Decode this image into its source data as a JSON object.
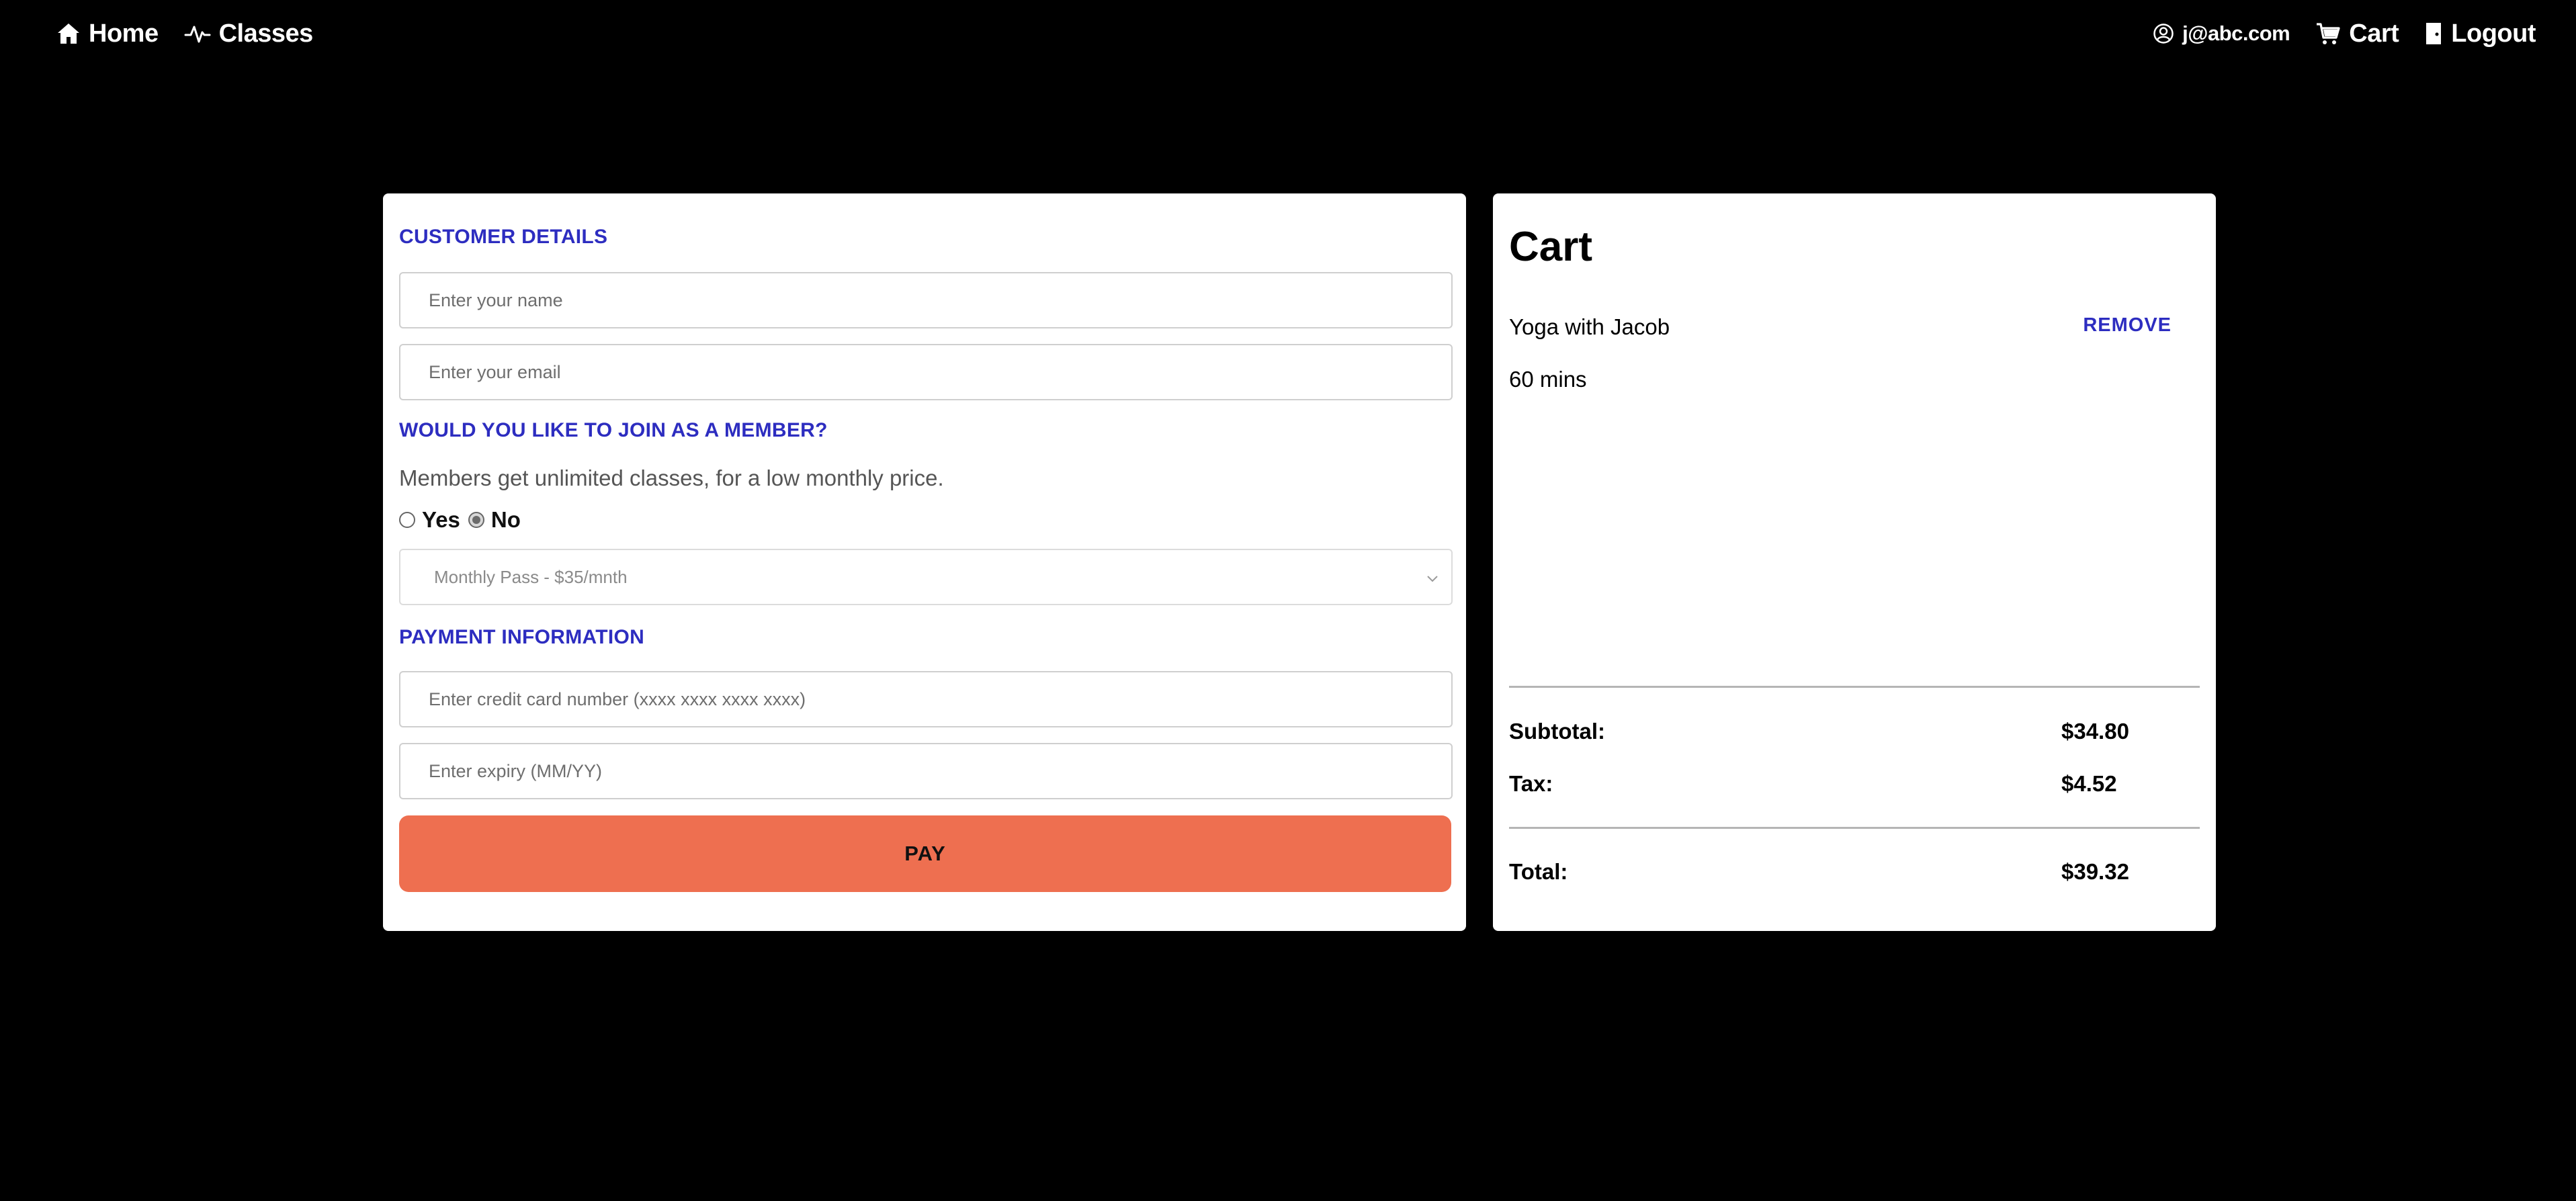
{
  "nav": {
    "home_label": "Home",
    "classes_label": "Classes",
    "user_label": "j@abc.com",
    "cart_label": "Cart",
    "logout_label": "Logout"
  },
  "customer": {
    "heading": "CUSTOMER DETAILS",
    "name_placeholder": "Enter your name",
    "email_placeholder": "Enter your email"
  },
  "membership": {
    "heading": "WOULD YOU LIKE TO JOIN AS A MEMBER?",
    "description": "Members get unlimited classes, for a low monthly price.",
    "yes_label": "Yes",
    "no_label": "No",
    "selected": "No",
    "plan_selected": "Monthly Pass - $35/mnth"
  },
  "payment": {
    "heading": "PAYMENT INFORMATION",
    "card_placeholder": "Enter credit card number (xxxx xxxx xxxx xxxx)",
    "expiry_placeholder": "Enter expiry (MM/YY)",
    "pay_label": "PAY"
  },
  "cart": {
    "title": "Cart",
    "items": [
      {
        "name": "Yoga with Jacob",
        "duration": "60 mins",
        "remove_label": "REMOVE"
      }
    ],
    "subtotal_label": "Subtotal:",
    "subtotal_value": "$34.80",
    "tax_label": "Tax:",
    "tax_value": "$4.52",
    "total_label": "Total:",
    "total_value": "$39.32"
  },
  "colors": {
    "background": "#000000",
    "accent": "#2d2dc0",
    "pay_button": "#ee6f50"
  }
}
